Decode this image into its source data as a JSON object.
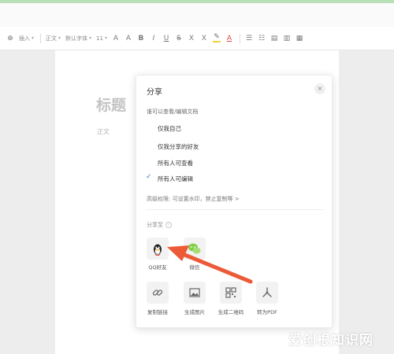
{
  "toolbar": {
    "insert_label": "插入",
    "style_label": "正文",
    "font_label": "默认字体",
    "size_label": "11",
    "icons": [
      "font-increase-icon",
      "font-decrease-icon",
      "bold-icon",
      "italic-icon",
      "underline-icon",
      "strikethrough-icon",
      "subscript-icon",
      "superscript-icon",
      "highlight-icon",
      "font-color-icon",
      "list-icon",
      "numbered-list-icon",
      "align-left-icon",
      "align-center-icon",
      "align-right-icon"
    ]
  },
  "document": {
    "title": "标题",
    "body": "正文"
  },
  "dialog": {
    "title": "分享",
    "close_glyph": "×",
    "permission_label": "谁可以查看/编辑文档",
    "options": [
      {
        "label": "仅我自己",
        "selected": false
      },
      {
        "label": "仅我分享的好友",
        "selected": false
      },
      {
        "label": "所有人可查看",
        "selected": false
      },
      {
        "label": "所有人可编辑",
        "selected": true
      }
    ],
    "check_glyph": "✓",
    "advanced_link": "高级权限: 可设置水印，禁止复制等 >",
    "share_to_label": "分享至",
    "info_glyph": "i",
    "targets": [
      {
        "label": "QQ好友",
        "icon": "qq-icon"
      },
      {
        "label": "微信",
        "icon": "wechat-icon"
      }
    ],
    "actions": [
      {
        "label": "复制链接",
        "icon": "link-icon"
      },
      {
        "label": "生成图片",
        "icon": "image-icon"
      },
      {
        "label": "生成二维码",
        "icon": "qrcode-icon"
      },
      {
        "label": "转为PDF",
        "icon": "pdf-icon"
      }
    ]
  },
  "colors": {
    "accent": "#3a7bd5",
    "arrow": "#ec5a37",
    "wechat": "#7fcf4a",
    "top_strip": "#b9dfb6"
  },
  "watermark": "爱创根知识网"
}
